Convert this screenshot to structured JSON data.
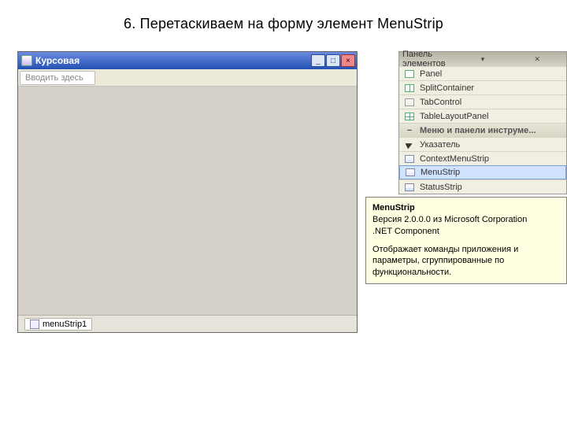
{
  "slide": {
    "title": "6. Перетаскиваем на форму элемент MenuStrip"
  },
  "form": {
    "title": "Курсовая",
    "menustrip_placeholder": "Вводить здесь",
    "tray_label": "menuStrip1"
  },
  "toolbox": {
    "header": "Панель элементов",
    "items": [
      {
        "label": "Panel"
      },
      {
        "label": "SplitContainer"
      },
      {
        "label": "TabControl"
      },
      {
        "label": "TableLayoutPanel"
      }
    ],
    "group_label": "Меню и панели инструме...",
    "group_items": [
      {
        "label": "Указатель"
      },
      {
        "label": "ContextMenuStrip"
      },
      {
        "label": "MenuStrip"
      },
      {
        "label": "StatusStrip"
      }
    ]
  },
  "tooltip": {
    "title": "MenuStrip",
    "version": "Версия 2.0.0.0 из Microsoft Corporation",
    "component": ".NET Component",
    "desc": "Отображает команды приложения и параметры, сгруппированные по функциональности."
  }
}
